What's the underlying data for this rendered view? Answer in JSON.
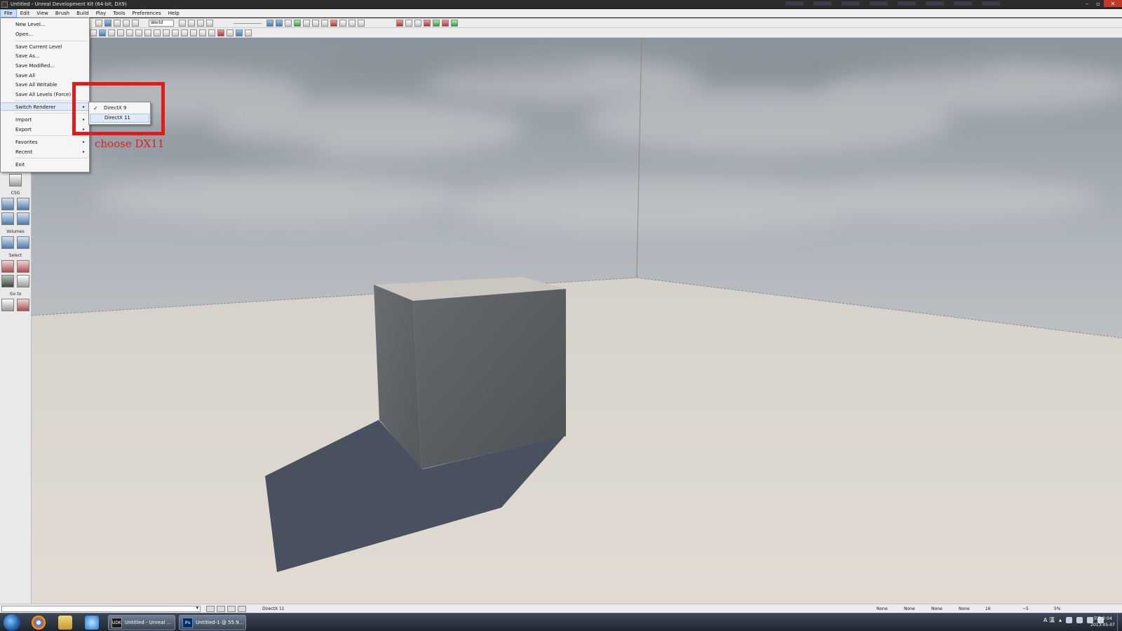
{
  "window": {
    "title": "Untitled - Unreal Development Kit (64-bit, DX9)",
    "controls": [
      "–",
      "▫",
      "✕"
    ]
  },
  "menubar": {
    "items": [
      "File",
      "Edit",
      "View",
      "Brush",
      "Build",
      "Play",
      "Tools",
      "Preferences",
      "Help"
    ],
    "active": "File"
  },
  "toolbar": {
    "coordinate_system": "World"
  },
  "file_menu": {
    "items": [
      {
        "label": "New Level..."
      },
      {
        "label": "Open..."
      },
      {
        "label": "Save Current Level"
      },
      {
        "label": "Save As..."
      },
      {
        "label": "Save Modified..."
      },
      {
        "label": "Save All"
      },
      {
        "label": "Save All Writable"
      },
      {
        "label": "Save All Levels (Force)"
      },
      {
        "label": "Switch Renderer",
        "submenu": true,
        "highlighted": true
      },
      {
        "label": "Import",
        "submenu": true
      },
      {
        "label": "Export",
        "submenu": true
      },
      {
        "label": "Favorites",
        "submenu": true
      },
      {
        "label": "Recent",
        "submenu": true
      },
      {
        "label": "Exit"
      }
    ]
  },
  "renderer_submenu": {
    "items": [
      {
        "label": "DirectX 9",
        "checked": true
      },
      {
        "label": "DirectX 11",
        "highlighted": true
      }
    ]
  },
  "annotation": {
    "text": "choose DX11",
    "color": "#e3191b"
  },
  "left_panel": {
    "sections": [
      "CSG",
      "Volumes",
      "Select",
      "Go to"
    ]
  },
  "statusbar": {
    "renderer": "DirectX 11",
    "snaps": [
      "None",
      "None",
      "None",
      "None"
    ],
    "grid": "16",
    "rotation": "~5",
    "scale": "5%"
  },
  "taskbar": {
    "apps": [
      {
        "icon": "UDK",
        "label": "Untitled - Unreal ..."
      },
      {
        "icon": "Ps",
        "label": "Untitled-1 @ 55.9..."
      }
    ],
    "tray_lang": "A 漢",
    "clock_time": "오후 2:04",
    "clock_date": "2013-05-07"
  }
}
